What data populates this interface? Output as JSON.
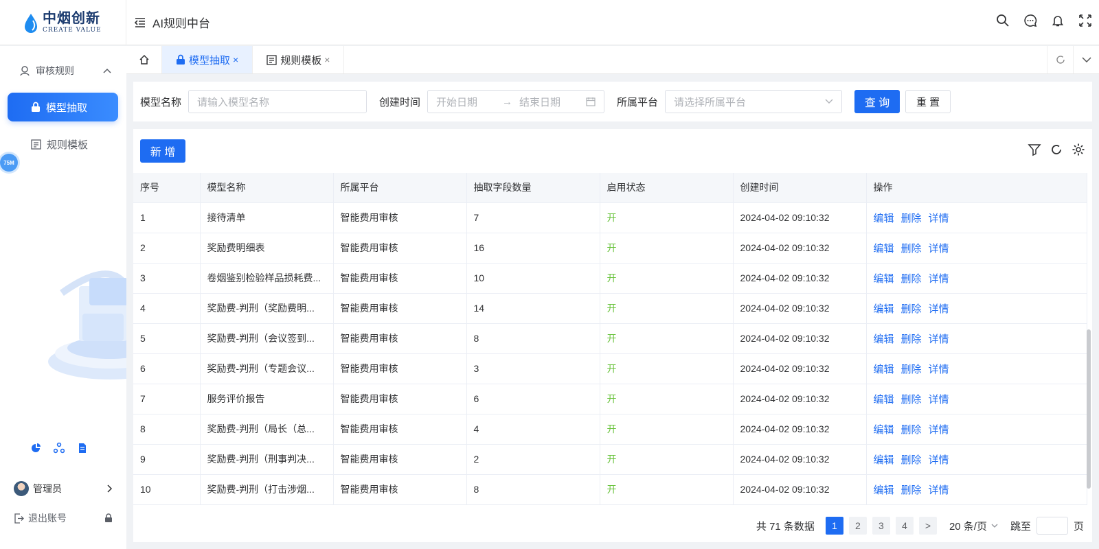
{
  "header": {
    "logo_cn": "中烟创新",
    "logo_en": "CREATE VALUE",
    "app_title": "AI规则中台"
  },
  "sidebar": {
    "group_label": "审核规则",
    "items": [
      {
        "label": "模型抽取",
        "active": true
      },
      {
        "label": "规则模板",
        "active": false
      }
    ],
    "fps_badge": "75M",
    "user_name": "管理员",
    "logout_label": "退出账号"
  },
  "tabs": [
    {
      "label": "模型抽取",
      "active": true
    },
    {
      "label": "规则模板",
      "active": false
    }
  ],
  "search": {
    "name_label": "模型名称",
    "name_placeholder": "请输入模型名称",
    "time_label": "创建时间",
    "start_placeholder": "开始日期",
    "range_sep": "→",
    "end_placeholder": "结束日期",
    "platform_label": "所属平台",
    "platform_placeholder": "请选择所属平台",
    "query_label": "查 询",
    "reset_label": "重 置"
  },
  "toolbar": {
    "add_label": "新 增"
  },
  "table": {
    "columns": [
      "序号",
      "模型名称",
      "所属平台",
      "抽取字段数量",
      "启用状态",
      "创建时间",
      "操作"
    ],
    "actions": [
      "编辑",
      "删除",
      "详情"
    ],
    "rows": [
      {
        "no": "1",
        "name": "接待清单",
        "platform": "智能费用审核",
        "fields": "7",
        "status": "开",
        "created": "2024-04-02 09:10:32"
      },
      {
        "no": "2",
        "name": "奖励费明细表",
        "platform": "智能费用审核",
        "fields": "16",
        "status": "开",
        "created": "2024-04-02 09:10:32"
      },
      {
        "no": "3",
        "name": "卷烟鉴别检验样品损耗费...",
        "platform": "智能费用审核",
        "fields": "10",
        "status": "开",
        "created": "2024-04-02 09:10:32"
      },
      {
        "no": "4",
        "name": "奖励费-判刑（奖励费明...",
        "platform": "智能费用审核",
        "fields": "14",
        "status": "开",
        "created": "2024-04-02 09:10:32"
      },
      {
        "no": "5",
        "name": "奖励费-判刑（会议签到...",
        "platform": "智能费用审核",
        "fields": "8",
        "status": "开",
        "created": "2024-04-02 09:10:32"
      },
      {
        "no": "6",
        "name": "奖励费-判刑（专题会议...",
        "platform": "智能费用审核",
        "fields": "3",
        "status": "开",
        "created": "2024-04-02 09:10:32"
      },
      {
        "no": "7",
        "name": "服务评价报告",
        "platform": "智能费用审核",
        "fields": "6",
        "status": "开",
        "created": "2024-04-02 09:10:32"
      },
      {
        "no": "8",
        "name": "奖励费-判刑（局长（总...",
        "platform": "智能费用审核",
        "fields": "4",
        "status": "开",
        "created": "2024-04-02 09:10:32"
      },
      {
        "no": "9",
        "name": "奖励费-判刑（刑事判决...",
        "platform": "智能费用审核",
        "fields": "2",
        "status": "开",
        "created": "2024-04-02 09:10:32"
      },
      {
        "no": "10",
        "name": "奖励费-判刑（打击涉烟...",
        "platform": "智能费用审核",
        "fields": "8",
        "status": "开",
        "created": "2024-04-02 09:10:32"
      }
    ]
  },
  "pagination": {
    "total_text": "共 71 条数据",
    "pages": [
      "1",
      "2",
      "3",
      "4"
    ],
    "current_page": "1",
    "next_label": ">",
    "page_size": "20 条/页",
    "jump_label": "跳至",
    "page_suffix": "页"
  },
  "colors": {
    "primary": "#1e6cf2",
    "status_on": "#67c23a"
  }
}
